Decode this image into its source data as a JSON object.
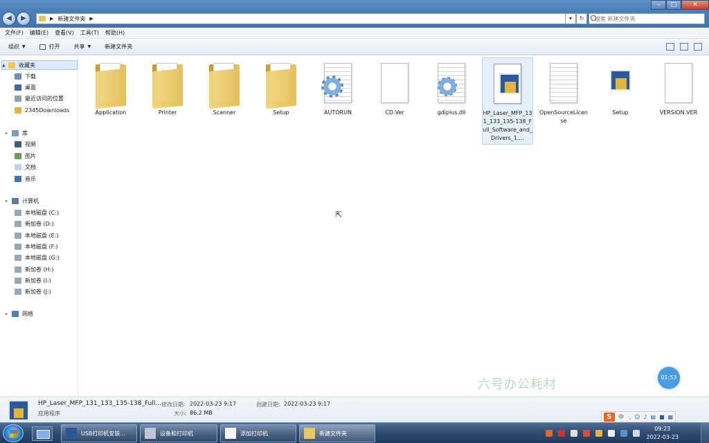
{
  "window": {
    "path": "新建文件夹",
    "search_placeholder": "搜索 新建文件夹"
  },
  "menu": [
    "文件(F)",
    "编辑(E)",
    "查看(V)",
    "工具(T)",
    "帮助(H)"
  ],
  "commands": {
    "organize": "组织",
    "print": "打开",
    "share": "共享",
    "new_folder": "新建文件夹"
  },
  "nav": {
    "favorites": "收藏夹",
    "favorites_items": [
      "下载",
      "桌面",
      "最近访问的位置",
      "2345Downloads"
    ],
    "libraries": "库",
    "library_items": [
      "视频",
      "图片",
      "文档",
      "音乐"
    ],
    "computer": "计算机",
    "drives": [
      "本地磁盘 (C:)",
      "新加卷 (D:)",
      "本地磁盘 (E:)",
      "本地磁盘 (F:)",
      "本地磁盘 (G:)",
      "新加卷 (H:)",
      "新加卷 (I:)",
      "新加卷 (J:)"
    ],
    "network": "网络"
  },
  "files": [
    {
      "name": "Application",
      "kind": "folder"
    },
    {
      "name": "Printer",
      "kind": "folder"
    },
    {
      "name": "Scanner",
      "kind": "folder"
    },
    {
      "name": "Setup",
      "kind": "folder"
    },
    {
      "name": "AUTORUN",
      "kind": "settings-file"
    },
    {
      "name": "CD.Ver",
      "kind": "blank-file"
    },
    {
      "name": "gdiplus.dll",
      "kind": "settings-file"
    },
    {
      "name": "HP_Laser_MFP_131_133_135-138_Full_Software_and_Drivers_1....",
      "kind": "installer",
      "selected": true
    },
    {
      "name": "OpenSourceLicense",
      "kind": "text-file"
    },
    {
      "name": "Setup",
      "kind": "installer"
    },
    {
      "name": "VERSION.VER",
      "kind": "blank-file"
    }
  ],
  "watermark": "六号办公耗材",
  "timer": "01:53",
  "details": {
    "name": "HP_Laser_MFP_131_133_135-138_Full...",
    "type": "应用程序",
    "modified_label": "修改日期:",
    "modified_value": "2022-03-23 9:17",
    "created_label": "创建日期:",
    "created_value": "2022-03-23 9:17",
    "size_label": "大小:",
    "size_value": "86.2 MB"
  },
  "ime": {
    "mode": "中"
  },
  "taskbar": {
    "buttons": [
      "USB打印机安装...",
      "设备和打印机",
      "添加打印机",
      "新建文件夹"
    ],
    "time": "09:23",
    "date": "2022-03-23"
  },
  "colors": {
    "accent": "#4a7fb8",
    "selection": "#dcebfc",
    "folder": "#e9c761",
    "watermark": "#b8dcc0",
    "timer": "#4a9be5"
  }
}
